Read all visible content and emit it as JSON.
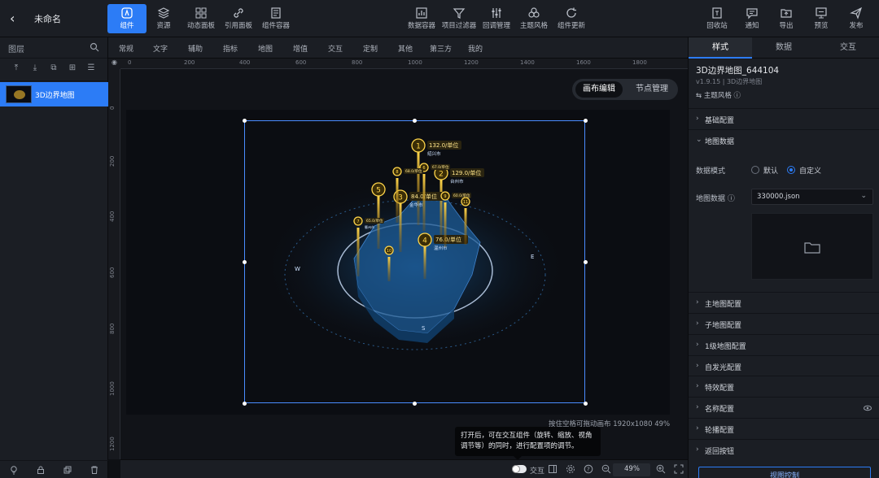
{
  "app": {
    "back_icon": "chevron-left-icon",
    "title": "未命名"
  },
  "toolbar_left": [
    {
      "label": "组件",
      "icon": "component-icon",
      "active": true
    },
    {
      "label": "资源",
      "icon": "layers-icon"
    },
    {
      "label": "动态面板",
      "icon": "dashboard-icon"
    },
    {
      "label": "引用面板",
      "icon": "link-icon"
    },
    {
      "label": "组件容器",
      "icon": "container-icon"
    }
  ],
  "toolbar_center": [
    {
      "label": "数据容器",
      "icon": "chart-box-icon"
    },
    {
      "label": "项目过滤器",
      "icon": "filter-icon"
    },
    {
      "label": "回调管理",
      "icon": "sliders-icon"
    },
    {
      "label": "主题风格",
      "icon": "palette-icon"
    },
    {
      "label": "组件更新",
      "icon": "refresh-icon"
    }
  ],
  "toolbar_right": [
    {
      "label": "回收站",
      "icon": "trash-icon"
    },
    {
      "label": "通知",
      "icon": "message-icon"
    },
    {
      "label": "导出",
      "icon": "export-icon"
    },
    {
      "label": "预览",
      "icon": "monitor-icon"
    },
    {
      "label": "发布",
      "icon": "send-icon"
    }
  ],
  "layers": {
    "title": "图层",
    "items": [
      {
        "label": "3D边界地图"
      }
    ]
  },
  "categories": [
    "常规",
    "文字",
    "辅助",
    "指标",
    "地图",
    "增值",
    "交互",
    "定制",
    "其他",
    "第三方",
    "我的"
  ],
  "ruler": {
    "h_ticks": [
      "0",
      "200",
      "400",
      "600",
      "800",
      "1000",
      "1200",
      "1400",
      "1600",
      "1800"
    ],
    "v_ticks": [
      "0",
      "200",
      "400",
      "600",
      "800",
      "1000",
      "1200"
    ]
  },
  "canvas": {
    "mode_edit": "画布编辑",
    "mode_node": "节点管理",
    "info": "按住空格可拖动画布  1920x1080 49%"
  },
  "map_markers": [
    {
      "rank": "1",
      "value": "132.0",
      "unit": "/单位",
      "city": "绍兴市"
    },
    {
      "rank": "2",
      "value": "129.0",
      "unit": "/单位",
      "city": "台州市"
    },
    {
      "rank": "3",
      "value": "84.0",
      "unit": "/单位",
      "city": "金华市"
    },
    {
      "rank": "4",
      "value": "76.0",
      "unit": "/单位",
      "city": "温州市"
    },
    {
      "rank": "5",
      "value": "",
      "unit": "",
      "city": ""
    },
    {
      "rank": "6",
      "value": "67.0",
      "unit": "/单位",
      "city": ""
    },
    {
      "rank": "7",
      "value": "65.0",
      "unit": "/单位",
      "city": "衢州市"
    },
    {
      "rank": "8",
      "value": "68.0",
      "unit": "/单位",
      "city": ""
    },
    {
      "rank": "9",
      "value": "60.0",
      "unit": "/单位",
      "city": ""
    },
    {
      "rank": "10",
      "value": "",
      "unit": "",
      "city": ""
    },
    {
      "rank": "11",
      "value": "",
      "unit": "",
      "city": ""
    }
  ],
  "tooltip": {
    "line1": "打开后，可在交互组件（旋转、缩放、视角",
    "line2": "调节等）的同时，进行配置项的调节。"
  },
  "bottombar": {
    "interact_label": "交互",
    "zoom": "49%"
  },
  "right_panel": {
    "tabs": [
      "样式",
      "数据",
      "交互"
    ],
    "component_name": "3D边界地图_644104",
    "version": "v1.9.15 | 3D边界地图",
    "theme_link": "⇆ 主题风格 ⓘ",
    "sections_top": [
      "基础配置",
      "地图数据"
    ],
    "data_mode_label": "数据模式",
    "data_mode_options": [
      "默认",
      "自定义"
    ],
    "data_mode_selected": "自定义",
    "map_data_label": "地图数据 ⓘ",
    "map_data_value": "330000.json",
    "sections_bottom": [
      "主地图配置",
      "子地图配置",
      "1级地图配置",
      "自发光配置",
      "特效配置",
      "名称配置",
      "轮播配置",
      "返回按钮"
    ],
    "bottom_button": "视图控制"
  }
}
